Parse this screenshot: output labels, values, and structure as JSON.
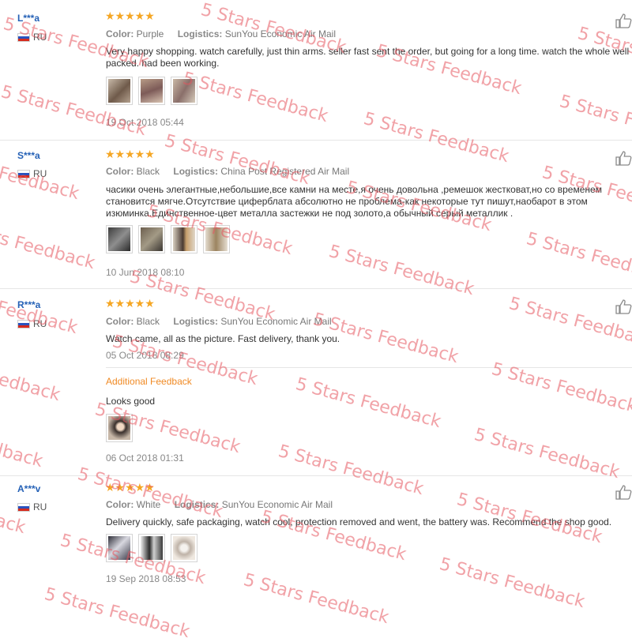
{
  "reviews": [
    {
      "user": "L***a",
      "country": "RU",
      "rating_stars": 5,
      "stars": "★★★★★",
      "color_label": "Color:",
      "color": "Purple",
      "logistics_label": "Logistics:",
      "logistics": "SunYou Economic Air Mail",
      "text": "Very happy shopping. watch carefully, just thin arms. seller fast sent the order, but going for a long time. watch the whole well packed. had been working.",
      "photo_count": 3,
      "date": "19 Oct 2018 05:44"
    },
    {
      "user": "S***a",
      "country": "RU",
      "rating_stars": 5,
      "stars": "★★★★★",
      "color_label": "Color:",
      "color": "Black",
      "logistics_label": "Logistics:",
      "logistics": "China Post Registered Air Mail",
      "text": "часики очень элегантные,небольшие,все камни на месте,я очень довольна ,ремешок жестковат,но со временем становится мягче.Отсутствие циферблата абсолютно не проблема-как некоторые тут пишут,наобарот в этом изюминка.Единственное-цвет металла застежки не под золото,а обычный серый металлик .",
      "photo_count": 4,
      "date": "10 Jun 2018 08:10"
    },
    {
      "user": "R***a",
      "country": "RU",
      "rating_stars": 5,
      "stars": "★★★★★",
      "color_label": "Color:",
      "color": "Black",
      "logistics_label": "Logistics:",
      "logistics": "SunYou Economic Air Mail",
      "text": "Watch came, all as the picture. Fast delivery, thank you.",
      "date": "05 Oct 2018 08:29",
      "additional": {
        "label": "Additional Feedback",
        "text": "Looks good",
        "photo_count": 1,
        "date": "06 Oct 2018 01:31"
      }
    },
    {
      "user": "A***v",
      "country": "RU",
      "rating_stars": 5,
      "stars": "★★★★★",
      "color_label": "Color:",
      "color": "White",
      "logistics_label": "Logistics:",
      "logistics": "SunYou Economic Air Mail",
      "text": "Delivery quickly, safe packaging, watch cool, protection removed and went, the battery was. Recommend the shop good.",
      "photo_count": 3,
      "date": "19 Sep 2018 08:53"
    }
  ],
  "watermark": "5 Stars Feedback",
  "colors": {
    "star": "#f5a623",
    "username": "#2561b6",
    "additional_label": "#f08a24",
    "watermark": "#e6555f"
  },
  "icons": {
    "like": "thumbs-up-icon",
    "flag": "russia-flag-icon"
  }
}
